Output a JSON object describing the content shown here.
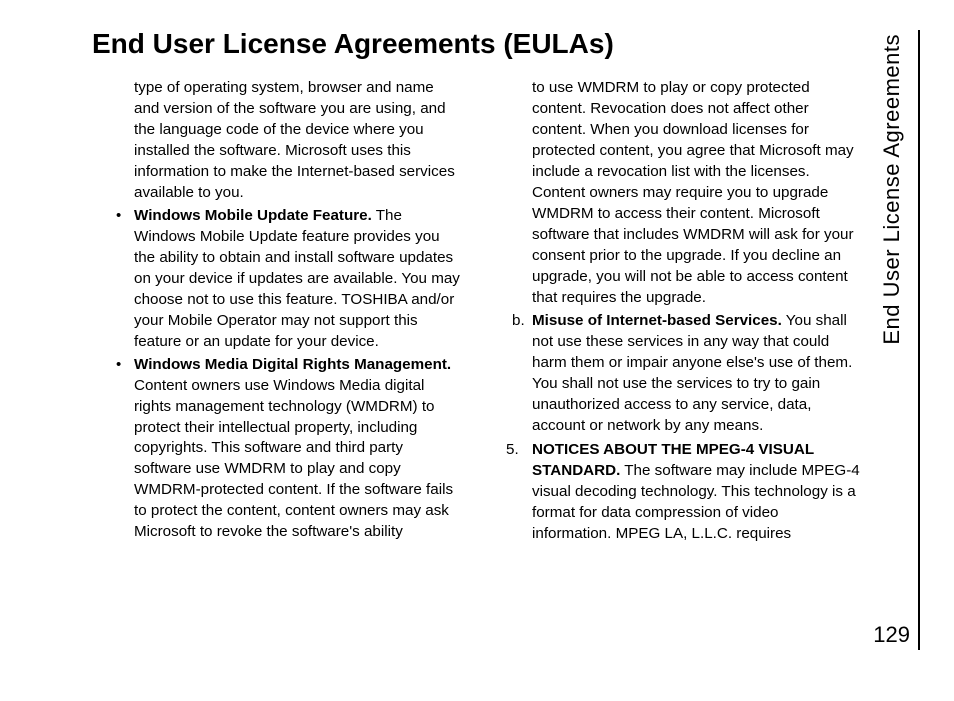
{
  "heading": "End User License Agreements (EULAs)",
  "sideLabel": "End User License Agreements",
  "pageNumber": "129",
  "col1": {
    "p0": "type of operating system, browser and name and version of the software you are using, and the language code of the device where you installed the software. Microsoft uses this information to make the Internet-based services available to you.",
    "wmu_title": "Windows Mobile Update Feature.",
    "wmu_body": " The Windows Mobile Update feature provides you the ability to obtain and install software updates on your device if updates are available. You may choose not to use this feature. TOSHIBA and/or your Mobile Operator may not support this feature or an update for your device.",
    "wmdrm_title": "Windows Media Digital Rights Management.",
    "wmdrm_body": " Content owners use Windows Media digital rights management technology (WMDRM) to protect their intellectual property, including copyrights. This software and third party software use WMDRM to play and copy WMDRM-protected content. If the software fails to protect the content, content owners may ask Microsoft to revoke the software's ability"
  },
  "col2": {
    "p0": "to use WMDRM to play or copy protected content. Revocation does not affect other content. When you download licenses for protected content, you agree that Microsoft may include a revocation list with the licenses. Content owners may require you to upgrade WMDRM to access their content. Microsoft software that includes WMDRM will ask for your consent prior to the upgrade. If you decline an upgrade, you will not be able to access content that requires the upgrade.",
    "b_marker": "b.",
    "b_title": "Misuse of Internet-based Services.",
    "b_body": " You shall not use these services in any way that could harm them or impair anyone else's use of them. You shall not use the services to try to gain unauthorized access to any service, data, account or network by any means.",
    "n5_marker": "5.",
    "n5_title": "NOTICES ABOUT THE MPEG-4 VISUAL STANDARD.",
    "n5_body": " The software may include MPEG-4 visual decoding technology. This technology is a format for data compression of video information. MPEG LA, L.L.C. requires"
  }
}
